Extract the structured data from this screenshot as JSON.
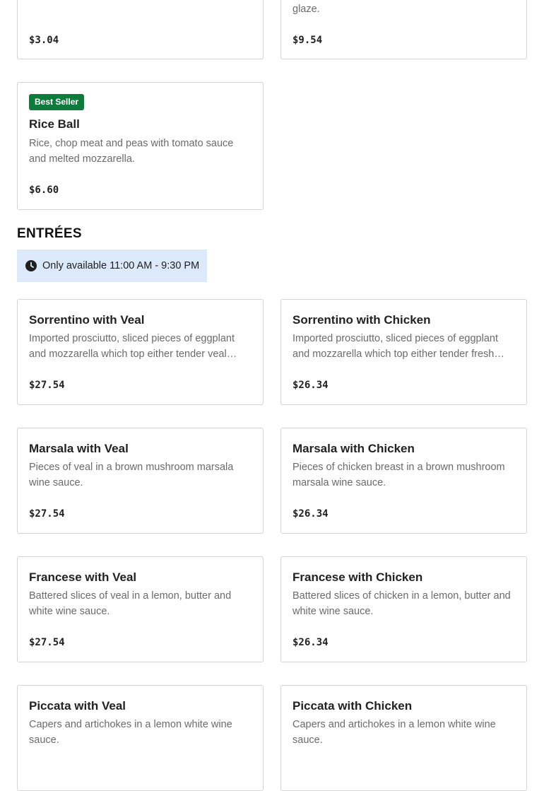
{
  "top_cards": [
    {
      "name": "",
      "description": "",
      "price": "$3.04"
    },
    {
      "name": "",
      "description": "glaze.",
      "price": "$9.54"
    }
  ],
  "featured": {
    "badge": "Best Seller",
    "name": "Rice Ball",
    "description": "Rice, chop meat and peas with tomato sauce and melted mozzarella.",
    "price": "$6.60"
  },
  "section": {
    "title": "ENTRÉES",
    "availability": "Only available 11:00 AM - 9:30 PM",
    "clock_icon": "clock-icon"
  },
  "items": [
    {
      "name": "Sorrentino with Veal",
      "description": "Imported prosciutto, sliced pieces of eggplant and mozzarella which top either tender veal scaloppine in a brown wine sauce.",
      "price": "$27.54"
    },
    {
      "name": "Sorrentino with Chicken",
      "description": "Imported prosciutto, sliced pieces of eggplant and mozzarella which top either tender fresh chicken breast in a brown wine sauce.",
      "price": "$26.34"
    },
    {
      "name": "Marsala with Veal",
      "description": "Pieces of veal in a brown mushroom marsala wine sauce.",
      "price": "$27.54"
    },
    {
      "name": "Marsala with Chicken",
      "description": "Pieces of chicken breast in a brown mushroom marsala wine sauce.",
      "price": "$26.34"
    },
    {
      "name": "Francese with Veal",
      "description": "Battered slices of veal in a lemon, butter and white wine sauce.",
      "price": "$27.54"
    },
    {
      "name": "Francese with Chicken",
      "description": "Battered slices of chicken in a lemon, butter and white wine sauce.",
      "price": "$26.34"
    },
    {
      "name": "Piccata with Veal",
      "description": "Capers and artichokes in a lemon white wine sauce.",
      "price": ""
    },
    {
      "name": "Piccata with Chicken",
      "description": "Capers and artichokes in a lemon white wine sauce.",
      "price": ""
    }
  ],
  "colors": {
    "badge_bg": "#0e7a3b",
    "hours_bg": "#dbe9fb",
    "card_border": "#d4d4d4"
  }
}
